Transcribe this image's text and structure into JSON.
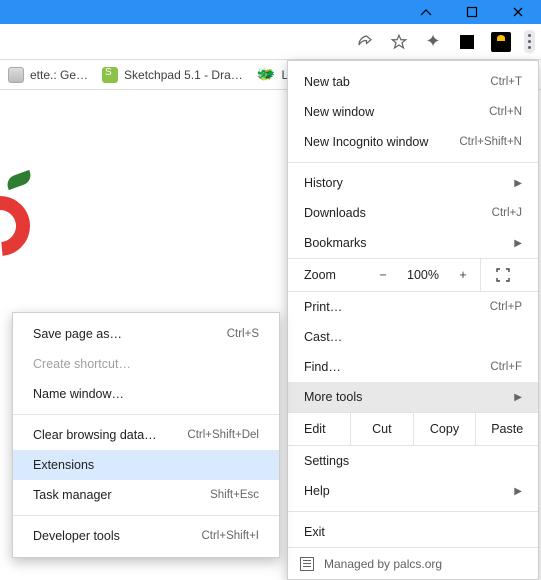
{
  "window_controls": {
    "minimize": "−",
    "maximize": "▢",
    "close": "✕"
  },
  "toolbar_icons": {
    "share": "share-icon",
    "star": "star-icon",
    "extensions": "puzzle-icon",
    "apps": "apps-icon",
    "profile": "profile-avatar",
    "menu": "more-menu"
  },
  "bookmarks": [
    {
      "label": "ette.: Ge…",
      "icon": "ge"
    },
    {
      "label": "Sketchpad 5.1 - Dra…",
      "icon": "sk"
    },
    {
      "label": "Lobby",
      "icon": "dragon"
    }
  ],
  "menu": {
    "new_tab": {
      "label": "New tab",
      "shortcut": "Ctrl+T"
    },
    "new_window": {
      "label": "New window",
      "shortcut": "Ctrl+N"
    },
    "new_incognito": {
      "label": "New Incognito window",
      "shortcut": "Ctrl+Shift+N"
    },
    "history": {
      "label": "History"
    },
    "downloads": {
      "label": "Downloads",
      "shortcut": "Ctrl+J"
    },
    "bookmarks": {
      "label": "Bookmarks"
    },
    "zoom": {
      "label": "Zoom",
      "minus": "−",
      "value": "100%",
      "plus": "+"
    },
    "print": {
      "label": "Print…",
      "shortcut": "Ctrl+P"
    },
    "cast": {
      "label": "Cast…"
    },
    "find": {
      "label": "Find…",
      "shortcut": "Ctrl+F"
    },
    "more_tools": {
      "label": "More tools"
    },
    "edit": {
      "label": "Edit",
      "cut": "Cut",
      "copy": "Copy",
      "paste": "Paste"
    },
    "settings": {
      "label": "Settings"
    },
    "help": {
      "label": "Help"
    },
    "exit": {
      "label": "Exit"
    },
    "managed": {
      "label": "Managed by palcs.org"
    }
  },
  "submenu": {
    "save_page": {
      "label": "Save page as…",
      "shortcut": "Ctrl+S"
    },
    "create_shortcut": {
      "label": "Create shortcut…"
    },
    "name_window": {
      "label": "Name window…"
    },
    "clear_browsing": {
      "label": "Clear browsing data…",
      "shortcut": "Ctrl+Shift+Del"
    },
    "extensions": {
      "label": "Extensions"
    },
    "task_manager": {
      "label": "Task manager",
      "shortcut": "Shift+Esc"
    },
    "developer_tools": {
      "label": "Developer tools",
      "shortcut": "Ctrl+Shift+I"
    }
  }
}
